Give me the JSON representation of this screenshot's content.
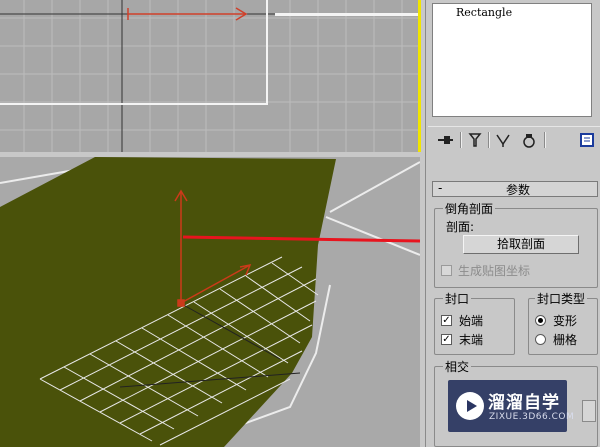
{
  "object_name": "Rectangle",
  "rollout": {
    "toggle": "-",
    "title": "参数"
  },
  "bevel_profile": {
    "group_title": "倒角剖面",
    "profile_label": "剖面:",
    "pick_button": "拾取剖面",
    "gen_map_coords": {
      "label": "生成贴图坐标",
      "checked": false,
      "enabled": false
    }
  },
  "capping": {
    "group_title": "封口",
    "start": {
      "label": "始端",
      "checked": true
    },
    "end": {
      "label": "末端",
      "checked": true
    }
  },
  "cap_type": {
    "group_title": "封口类型",
    "options": [
      {
        "label": "变形",
        "selected": true
      },
      {
        "label": "栅格",
        "selected": false
      }
    ]
  },
  "intersect": {
    "group_title": "相交"
  },
  "watermark": {
    "title": "溜溜自学",
    "subtitle": "ZIXUE.3D66.COM"
  },
  "toolbar_icons": [
    "pin-stack-icon",
    "funnel-icon",
    "make-unique-icon",
    "remove-modifier-icon",
    "configure-icon"
  ],
  "colors": {
    "viewport_active_border": "#f2e600",
    "shape_fill": "#4a520a",
    "annotation_arrow": "#e8141e",
    "gizmo": "#cc3a1a"
  }
}
